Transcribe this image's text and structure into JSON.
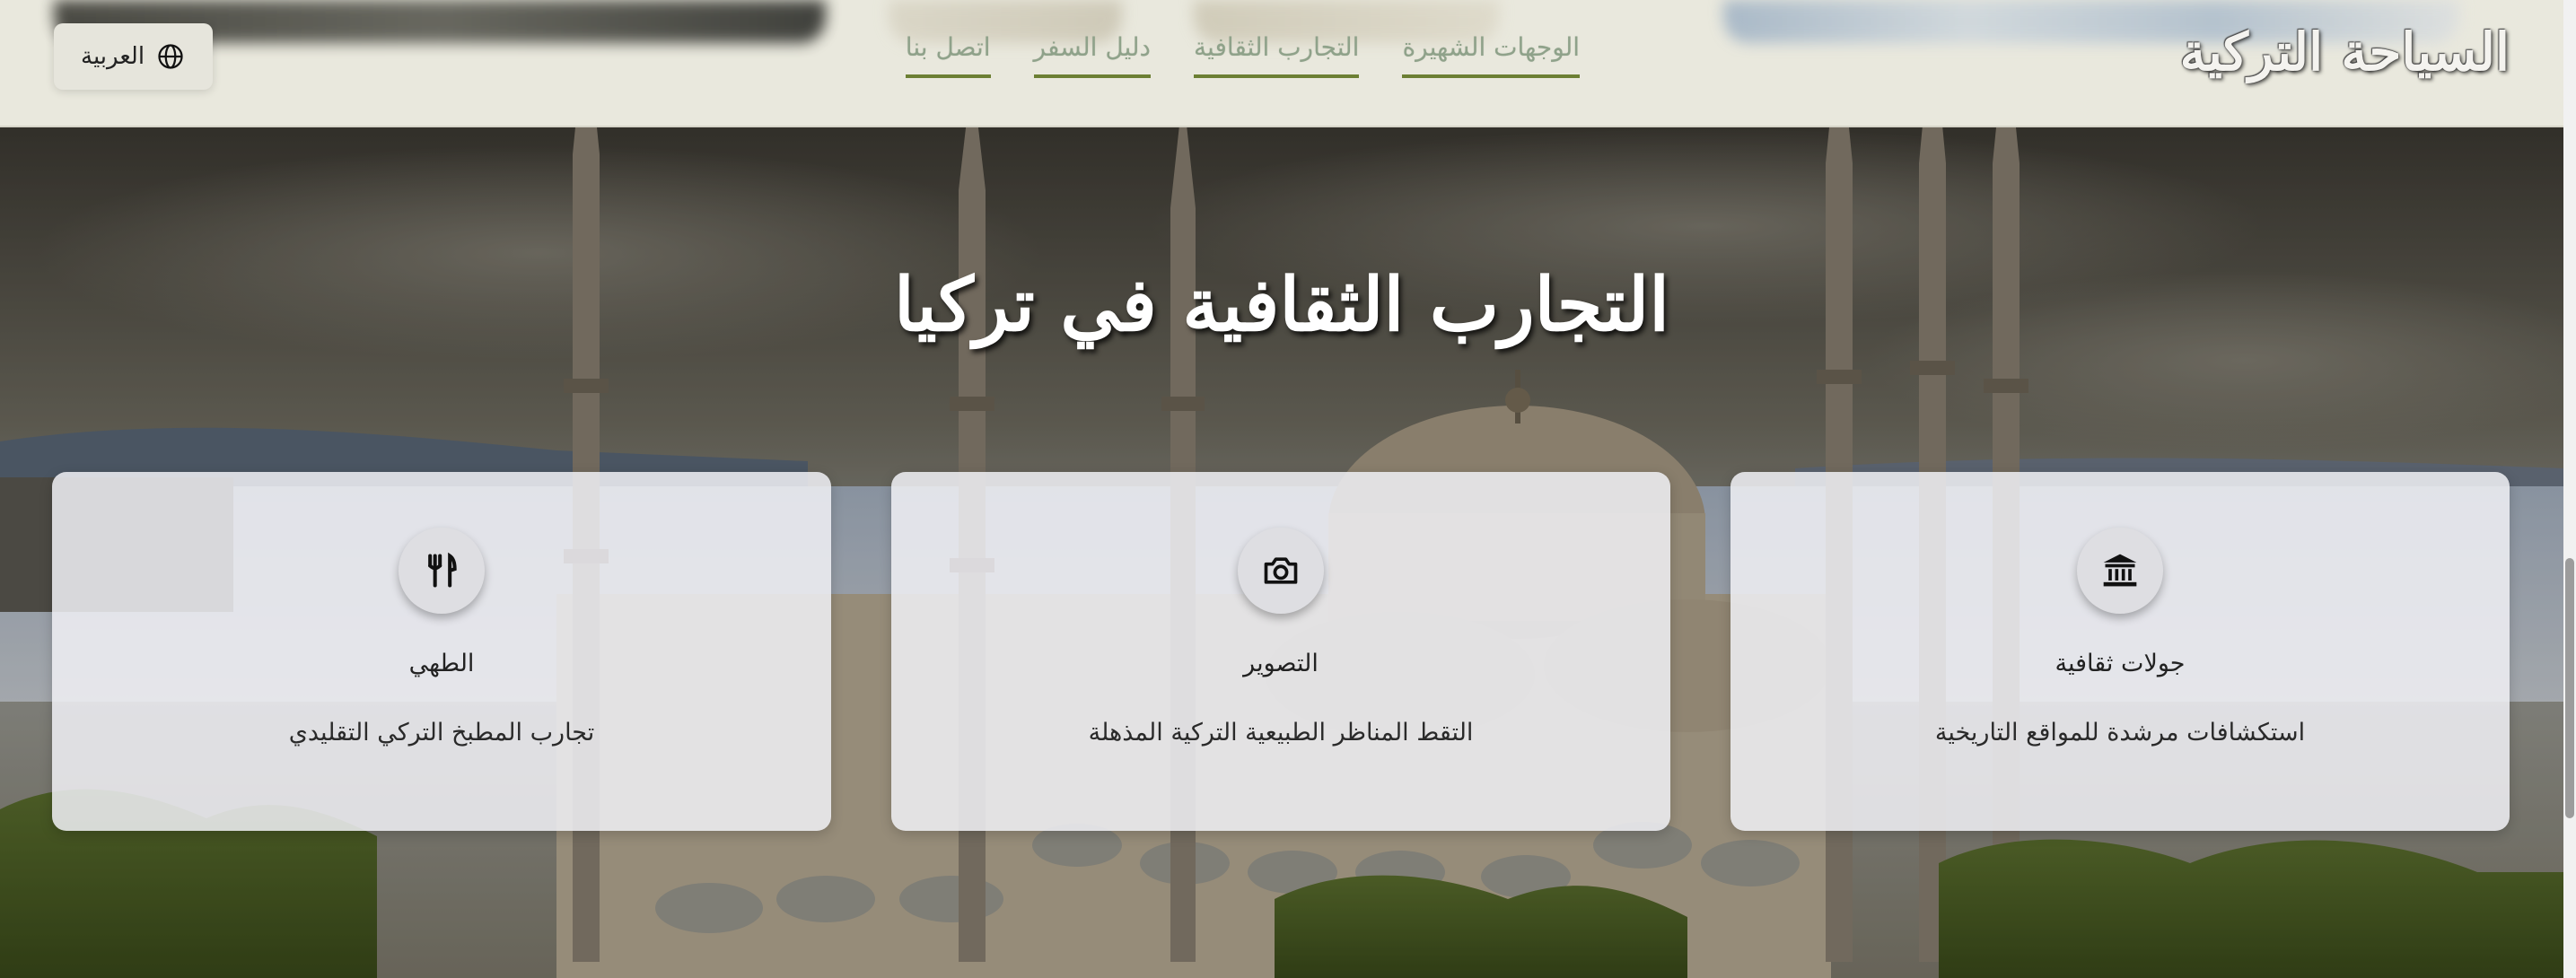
{
  "header": {
    "brand": "السياحة التركية",
    "nav": [
      {
        "label": "الوجهات الشهيرة"
      },
      {
        "label": "التجارب الثقافية"
      },
      {
        "label": "دليل السفر"
      },
      {
        "label": "اتصل بنا"
      }
    ],
    "language": {
      "label": "العربية",
      "icon": "globe-icon"
    }
  },
  "hero": {
    "title": "التجارب الثقافية في تركيا",
    "background": "istanbul-blue-mosque-photo",
    "cards": [
      {
        "icon": "landmark-icon",
        "title": "جولات ثقافية",
        "description": "استكشافات مرشدة للمواقع التاريخية"
      },
      {
        "icon": "camera-icon",
        "title": "التصوير",
        "description": "التقط المناظر الطبيعية التركية المذهلة"
      },
      {
        "icon": "utensils-icon",
        "title": "الطهي",
        "description": "تجارب المطبخ التركي التقليدي"
      }
    ]
  },
  "colors": {
    "nav_text": "#8fa28a",
    "nav_underline": "#6c7f33",
    "header_bg": "#e9e8dd",
    "card_bg": "#f0f0f5"
  }
}
